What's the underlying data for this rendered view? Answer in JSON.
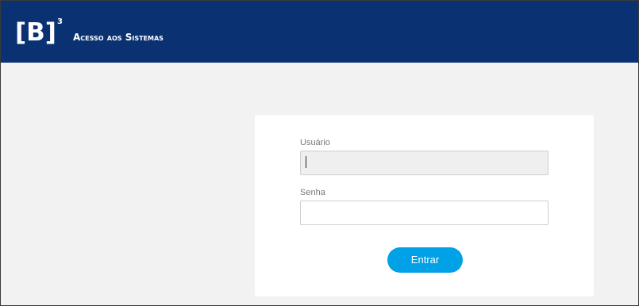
{
  "header": {
    "logo": {
      "text": "[B]",
      "superscript": "3"
    },
    "title": "Acesso aos Sistemas"
  },
  "login_form": {
    "username": {
      "label": "Usuário",
      "value": "",
      "placeholder": "",
      "focused": true
    },
    "password": {
      "label": "Senha",
      "value": "",
      "placeholder": ""
    },
    "submit_label": "Entrar"
  },
  "colors": {
    "header_background": "#0a3272",
    "button_background": "#00a1e6",
    "page_background": "#f2f2f2"
  }
}
